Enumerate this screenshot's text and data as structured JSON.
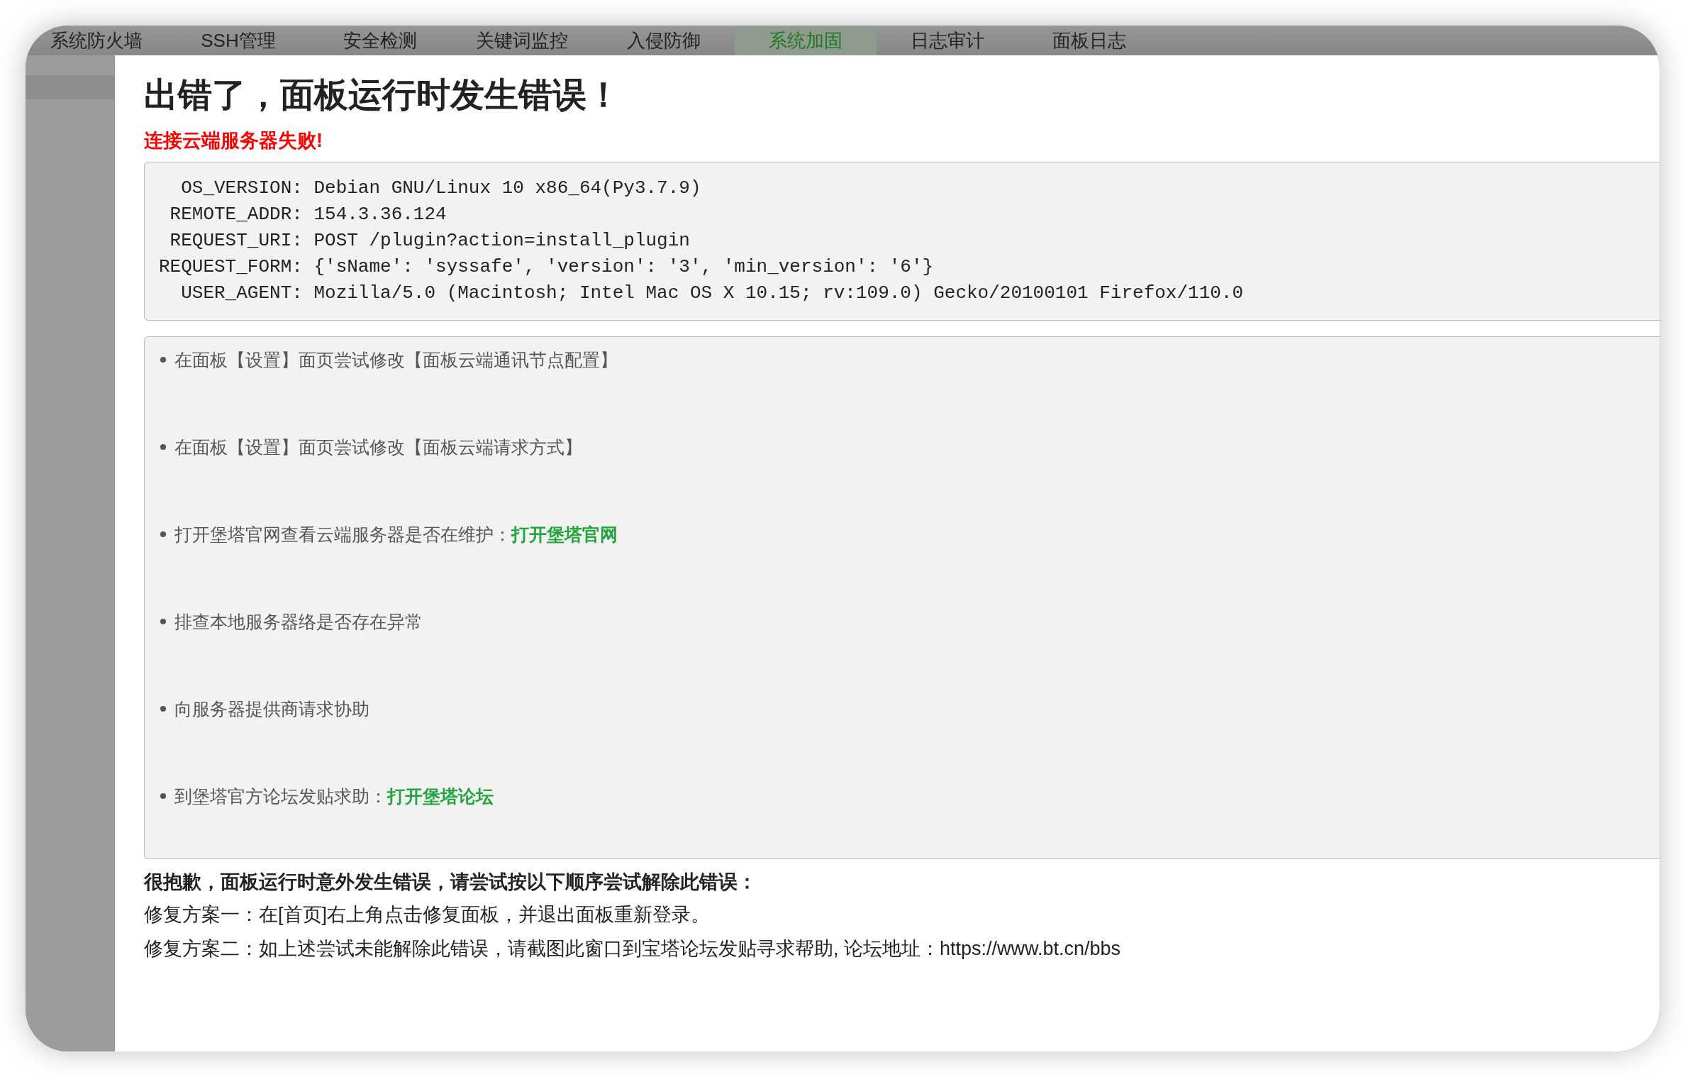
{
  "tabs": [
    {
      "label": "系统防火墙",
      "selected": false
    },
    {
      "label": "SSH管理",
      "selected": false
    },
    {
      "label": "安全检测",
      "selected": false
    },
    {
      "label": "关键词监控",
      "selected": false
    },
    {
      "label": "入侵防御",
      "selected": false
    },
    {
      "label": "系统加固",
      "selected": true
    },
    {
      "label": "日志审计",
      "selected": false
    },
    {
      "label": "面板日志",
      "selected": false
    }
  ],
  "dialog": {
    "title": "出错了，面板运行时发生错误！",
    "error_message": "连接云端服务器失败!",
    "details": [
      "  OS_VERSION: Debian GNU/Linux 10 x86_64(Py3.7.9)",
      " REMOTE_ADDR: 154.3.36.124",
      " REQUEST_URI: POST /plugin?action=install_plugin",
      "REQUEST_FORM: {'sName': 'syssafe', 'version': '3', 'min_version': '6'}",
      "  USER_AGENT: Mozilla/5.0 (Macintosh; Intel Mac OS X 10.15; rv:109.0) Gecko/20100101 Firefox/110.0"
    ],
    "suggestions": [
      {
        "text": "在面板【设置】面页尝试修改【面板云端通讯节点配置】"
      },
      {
        "text": "在面板【设置】面页尝试修改【面板云端请求方式】"
      },
      {
        "text": "打开堡塔官网查看云端服务器是否在维护：",
        "link": "打开堡塔官网"
      },
      {
        "text": "排查本地服务器络是否存在异常"
      },
      {
        "text": "向服务器提供商请求协助"
      },
      {
        "text": "到堡塔官方论坛发贴求助：",
        "link": "打开堡塔论坛"
      }
    ],
    "apology": "很抱歉，面板运行时意外发生错误，请尝试按以下顺序尝试解除此错误：",
    "fixes": [
      "修复方案一：在[首页]右上角点击修复面板，并退出面板重新登录。",
      "修复方案二：如上述尝试未能解除此错误，请截图此窗口到宝塔论坛发贴寻求帮助, 论坛地址：https://www.bt.cn/bbs"
    ]
  }
}
